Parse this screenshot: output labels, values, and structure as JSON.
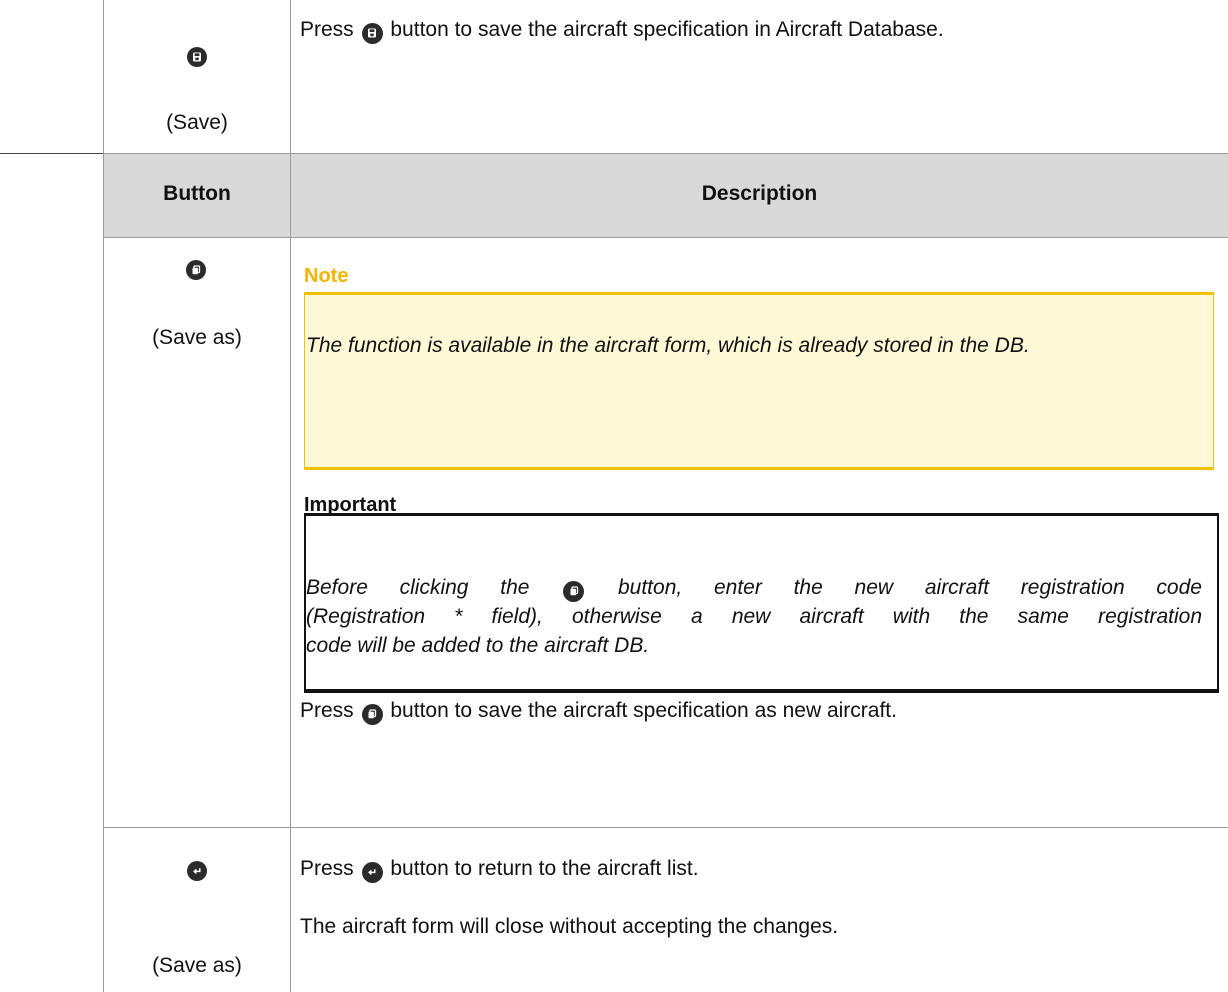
{
  "rows": {
    "save": {
      "label": "(Save)",
      "icon": "save-icon",
      "desc_before": "Press",
      "desc_after": "button to save the aircraft specification in Aircraft Database."
    },
    "header": {
      "button": "Button",
      "description": "Description"
    },
    "save_as": {
      "label": "(Save as)",
      "icon": "copy-icon",
      "note_title": "Note",
      "note_text": "The function is available in the aircraft form, which is already stored in the DB.",
      "important_title": "Important",
      "important_line1_before": "Before clicking the",
      "important_line1_after": "button, enter the new aircraft registration code",
      "important_line2": "(Registration * field), otherwise a new aircraft with the same registration",
      "important_line3": "code will be added to the aircraft DB.",
      "desc_before": "Press",
      "desc_after": "button to save the aircraft specification as new aircraft."
    },
    "back": {
      "label": "(Save as)",
      "icon": "return-icon",
      "desc_before": "Press",
      "desc_after": "button to return to the aircraft list.",
      "desc_line2": "The aircraft form will close without accepting the changes."
    }
  },
  "colors": {
    "note_title": "#f4b400",
    "note_bg": "#fff8d6",
    "header_bg": "#d9d9d9"
  }
}
